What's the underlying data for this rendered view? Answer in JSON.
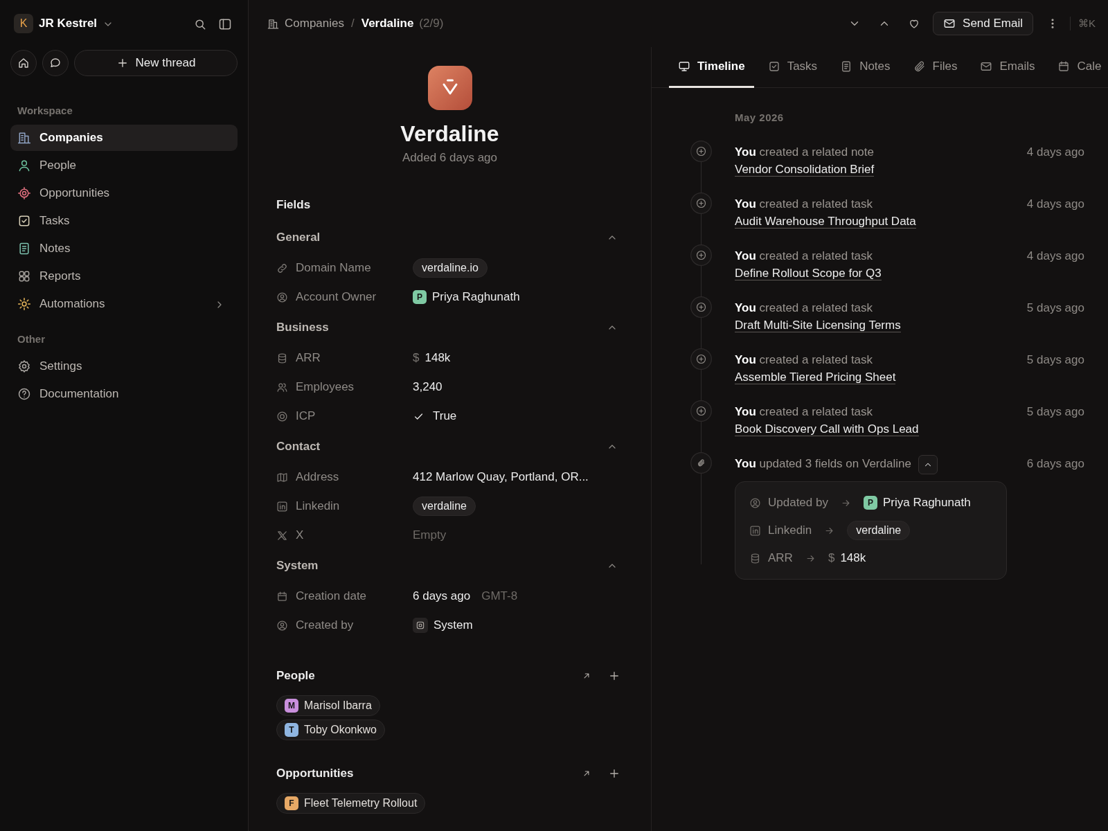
{
  "workspace": {
    "initial": "K",
    "name": "JR Kestrel"
  },
  "new_thread": "New thread",
  "sidebar": {
    "sections": [
      {
        "title": "Workspace",
        "items": [
          {
            "label": "Companies",
            "kind": "link",
            "selected": true
          },
          {
            "label": "People",
            "kind": "link",
            "selected": false
          },
          {
            "label": "Opportunities",
            "kind": "link",
            "selected": false
          },
          {
            "label": "Tasks",
            "kind": "link",
            "selected": false
          },
          {
            "label": "Notes",
            "kind": "link",
            "selected": false
          },
          {
            "label": "Reports",
            "kind": "link",
            "selected": false
          },
          {
            "label": "Automations",
            "kind": "group",
            "selected": false
          }
        ]
      },
      {
        "title": "Other",
        "items": [
          {
            "label": "Settings",
            "kind": "link",
            "selected": false
          },
          {
            "label": "Documentation",
            "kind": "link",
            "selected": false
          }
        ]
      }
    ]
  },
  "breadcrumb": {
    "section": "Companies",
    "separator": "/",
    "current": "Verdaline",
    "position": "(2/9)"
  },
  "toolbar": {
    "send_email": "Send Email",
    "shortcut": "⌘K"
  },
  "record": {
    "name": "Verdaline",
    "added": "Added 6 days ago"
  },
  "fields_title": "Fields",
  "field_groups": [
    {
      "title": "General",
      "expanded": true,
      "fields": [
        {
          "label": "Domain Name",
          "kind": "chip",
          "value": "verdaline.io"
        },
        {
          "label": "Account Owner",
          "kind": "person",
          "initial": "P",
          "color": "#7fc9a3",
          "value": "Priya Raghunath"
        }
      ]
    },
    {
      "title": "Business",
      "expanded": true,
      "fields": [
        {
          "label": "ARR",
          "kind": "currency",
          "symbol": "$",
          "value": "148k"
        },
        {
          "label": "Employees",
          "kind": "text",
          "value": "3,240"
        },
        {
          "label": "ICP",
          "kind": "boolean",
          "value": "True"
        }
      ]
    },
    {
      "title": "Contact",
      "expanded": true,
      "fields": [
        {
          "label": "Address",
          "kind": "text",
          "value": "412 Marlow Quay, Portland, OR..."
        },
        {
          "label": "Linkedin",
          "kind": "chip",
          "value": "verdaline"
        },
        {
          "label": "X",
          "kind": "empty",
          "value": "Empty"
        }
      ]
    },
    {
      "title": "System",
      "expanded": true,
      "fields": [
        {
          "label": "Creation date",
          "kind": "date",
          "value": "6 days ago",
          "timezone": "GMT-8"
        },
        {
          "label": "Created by",
          "kind": "system",
          "value": "System"
        }
      ]
    }
  ],
  "relations": [
    {
      "title": "People",
      "items": [
        {
          "initial": "M",
          "color": "#c98fdc",
          "name": "Marisol Ibarra"
        },
        {
          "initial": "T",
          "color": "#8fb5e0",
          "name": "Toby Okonkwo"
        }
      ]
    },
    {
      "title": "Opportunities",
      "items": [
        {
          "initial": "F",
          "color": "#e6a865",
          "name": "Fleet Telemetry Rollout"
        }
      ]
    }
  ],
  "tabs": [
    {
      "label": "Timeline",
      "selected": true
    },
    {
      "label": "Tasks",
      "selected": false
    },
    {
      "label": "Notes",
      "selected": false
    },
    {
      "label": "Files",
      "selected": false
    },
    {
      "label": "Emails",
      "selected": false
    },
    {
      "label": "Cale",
      "selected": false
    }
  ],
  "timeline": {
    "month": "May 2026",
    "events": [
      {
        "kind": "created",
        "actor": "You",
        "action": "created a related note",
        "link": "Vendor Consolidation Brief",
        "time": "4 days ago"
      },
      {
        "kind": "created",
        "actor": "You",
        "action": "created a related task",
        "link": "Audit Warehouse Throughput Data",
        "time": "4 days ago"
      },
      {
        "kind": "created",
        "actor": "You",
        "action": "created a related task",
        "link": "Define Rollout Scope for Q3",
        "time": "4 days ago"
      },
      {
        "kind": "created",
        "actor": "You",
        "action": "created a related task",
        "link": "Draft Multi-Site Licensing Terms",
        "time": "5 days ago"
      },
      {
        "kind": "created",
        "actor": "You",
        "action": "created a related task",
        "link": "Assemble Tiered Pricing Sheet",
        "time": "5 days ago"
      },
      {
        "kind": "created",
        "actor": "You",
        "action": "created a related task",
        "link": "Book Discovery Call with Ops Lead",
        "time": "5 days ago"
      },
      {
        "kind": "updated",
        "actor": "You",
        "action": "updated 3 fields on Verdaline",
        "time": "6 days ago",
        "expanded": true,
        "changes": [
          {
            "label": "Updated by",
            "kind": "person",
            "initial": "P",
            "color": "#7fc9a3",
            "value": "Priya Raghunath"
          },
          {
            "label": "Linkedin",
            "kind": "chip",
            "value": "verdaline"
          },
          {
            "label": "ARR",
            "kind": "currency",
            "symbol": "$",
            "value": "148k"
          }
        ]
      }
    ]
  }
}
